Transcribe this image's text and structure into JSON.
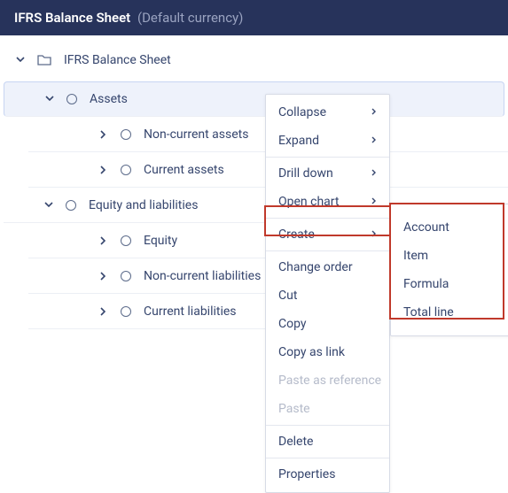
{
  "header": {
    "title": "IFRS Balance Sheet",
    "subtitle": "(Default currency)"
  },
  "tree": {
    "root": {
      "label": "IFRS Balance Sheet"
    },
    "assets": {
      "label": "Assets"
    },
    "non_current_assets": {
      "label": "Non-current assets"
    },
    "current_assets": {
      "label": "Current assets"
    },
    "equity_liabilities": {
      "label": "Equity and liabilities"
    },
    "equity": {
      "label": "Equity"
    },
    "non_current_liabilities": {
      "label": "Non-current liabilities"
    },
    "current_liabilities": {
      "label": "Current liabilities"
    }
  },
  "context_menu": {
    "collapse": "Collapse",
    "expand": "Expand",
    "drill_down": "Drill down",
    "open_chart": "Open chart",
    "create": "Create",
    "change_order": "Change order",
    "cut": "Cut",
    "copy": "Copy",
    "copy_as_link": "Copy as link",
    "paste_as_reference": "Paste as reference",
    "paste": "Paste",
    "delete": "Delete",
    "properties": "Properties"
  },
  "create_submenu": {
    "account": "Account",
    "item": "Item",
    "formula": "Formula",
    "total_line": "Total line"
  }
}
